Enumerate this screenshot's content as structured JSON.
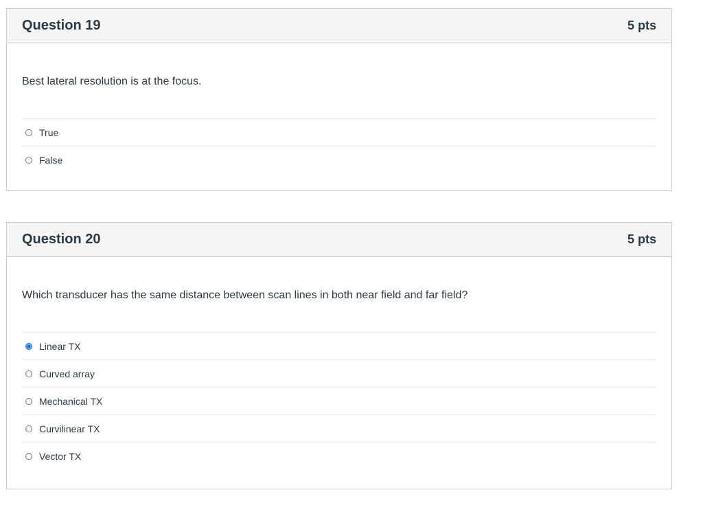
{
  "questions": [
    {
      "title": "Question 19",
      "points": "5 pts",
      "text": "Best lateral resolution is at the focus.",
      "answers": [
        {
          "label": "True",
          "selected": false
        },
        {
          "label": "False",
          "selected": false
        }
      ]
    },
    {
      "title": "Question 20",
      "points": "5 pts",
      "text": "Which transducer has the same distance between scan lines in both near field and far field?",
      "answers": [
        {
          "label": "Linear TX",
          "selected": true
        },
        {
          "label": "Curved array",
          "selected": false
        },
        {
          "label": "Mechanical TX",
          "selected": false
        },
        {
          "label": "Curvilinear TX",
          "selected": false
        },
        {
          "label": "Vector TX",
          "selected": false
        }
      ]
    }
  ],
  "colors": {
    "accent": "#0770d4",
    "header_bg": "#f5f5f5",
    "border": "#c7cdd1",
    "text": "#2d3b45"
  }
}
